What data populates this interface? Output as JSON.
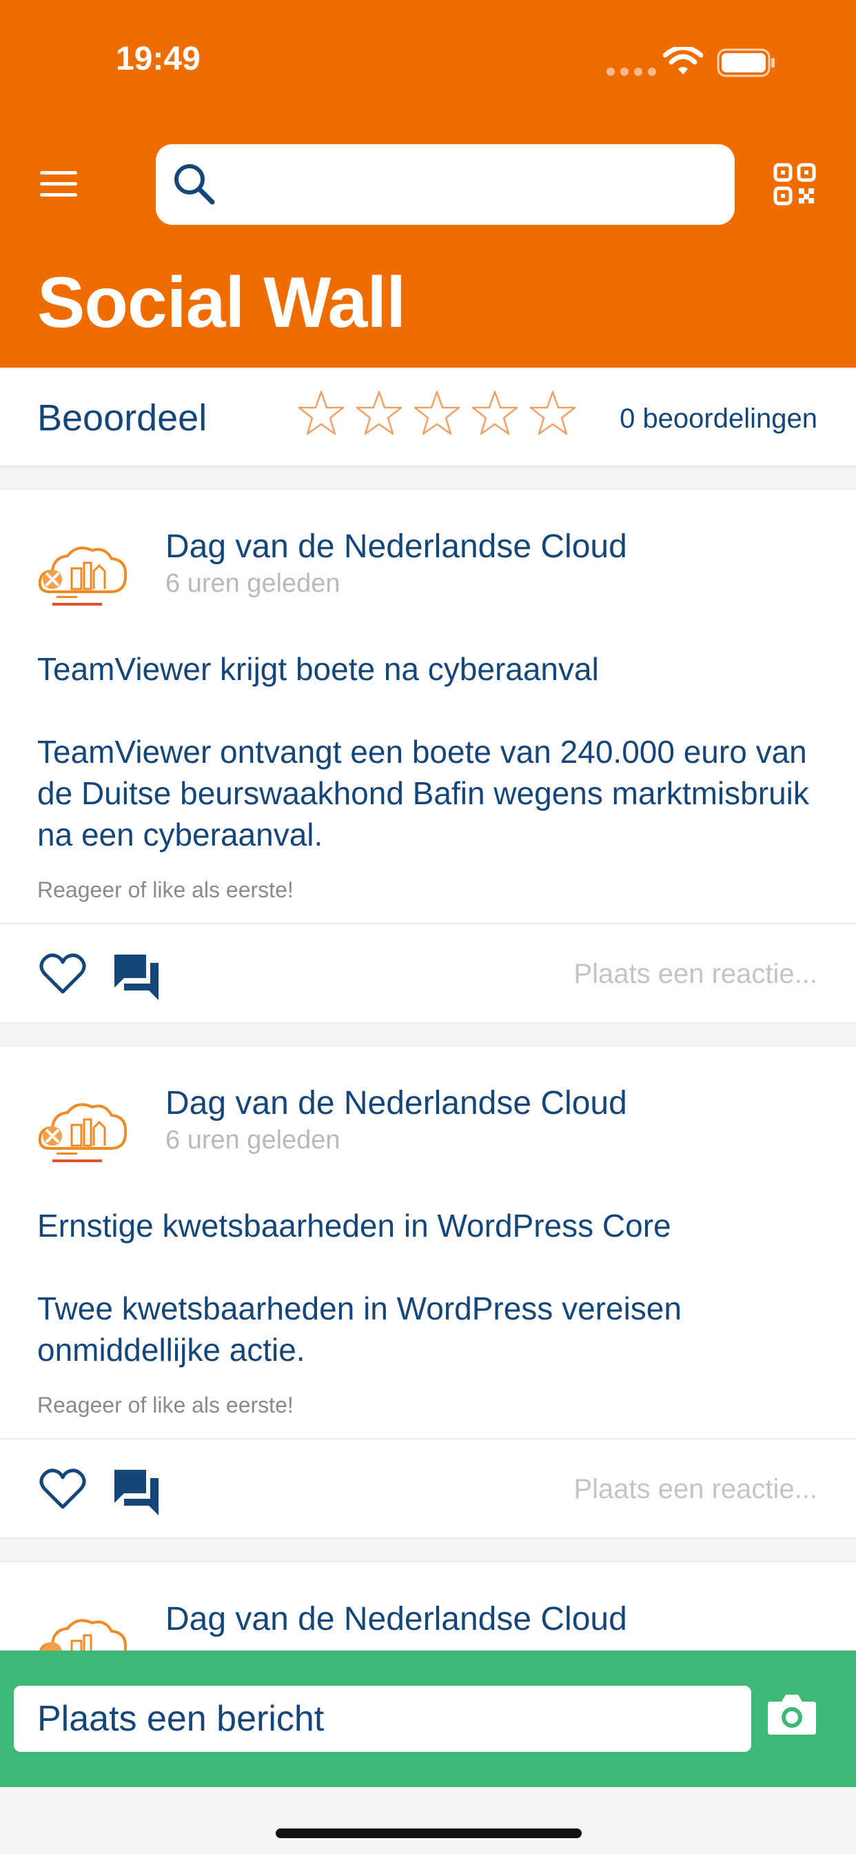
{
  "status_bar": {
    "time": "19:49"
  },
  "header": {
    "title": "Social Wall",
    "search_placeholder": ""
  },
  "rating": {
    "label": "Beoordeel",
    "stars_filled": 0,
    "stars_total": 5,
    "count_text": "0 beoordelingen"
  },
  "posts": [
    {
      "author": "Dag van de Nederlandse Cloud",
      "time": "6 uren geleden",
      "body": "TeamViewer krijgt boete na cyberaanval\n\nTeamViewer ontvangt een boete van 240.000 euro van de Duitse beurswaakhond Bafin wegens marktmisbruik na een cyberaanval.",
      "hint": "Reageer of like als eerste!",
      "comment_placeholder": "Plaats een reactie..."
    },
    {
      "author": "Dag van de Nederlandse Cloud",
      "time": "6 uren geleden",
      "body": "Ernstige kwetsbaarheden in WordPress Core\n\nTwee kwetsbaarheden in WordPress vereisen onmiddellijke actie.",
      "hint": "Reageer of like als eerste!",
      "comment_placeholder": "Plaats een reactie..."
    },
    {
      "author": "Dag van de Nederlandse Cloud"
    }
  ],
  "composer": {
    "placeholder": "Plaats een bericht"
  },
  "icons": {
    "menu": "menu-icon",
    "search": "search-icon",
    "qr": "qr-code-icon",
    "star": "star-outline-icon",
    "like": "heart-outline-icon",
    "comment": "chat-bubbles-icon",
    "camera": "camera-icon"
  },
  "colors": {
    "brand_orange": "#ef6c00",
    "text_blue": "#15467a",
    "composer_green": "#3db877",
    "muted_gray": "#b9b9b9",
    "star_orange": "#f0a067"
  }
}
